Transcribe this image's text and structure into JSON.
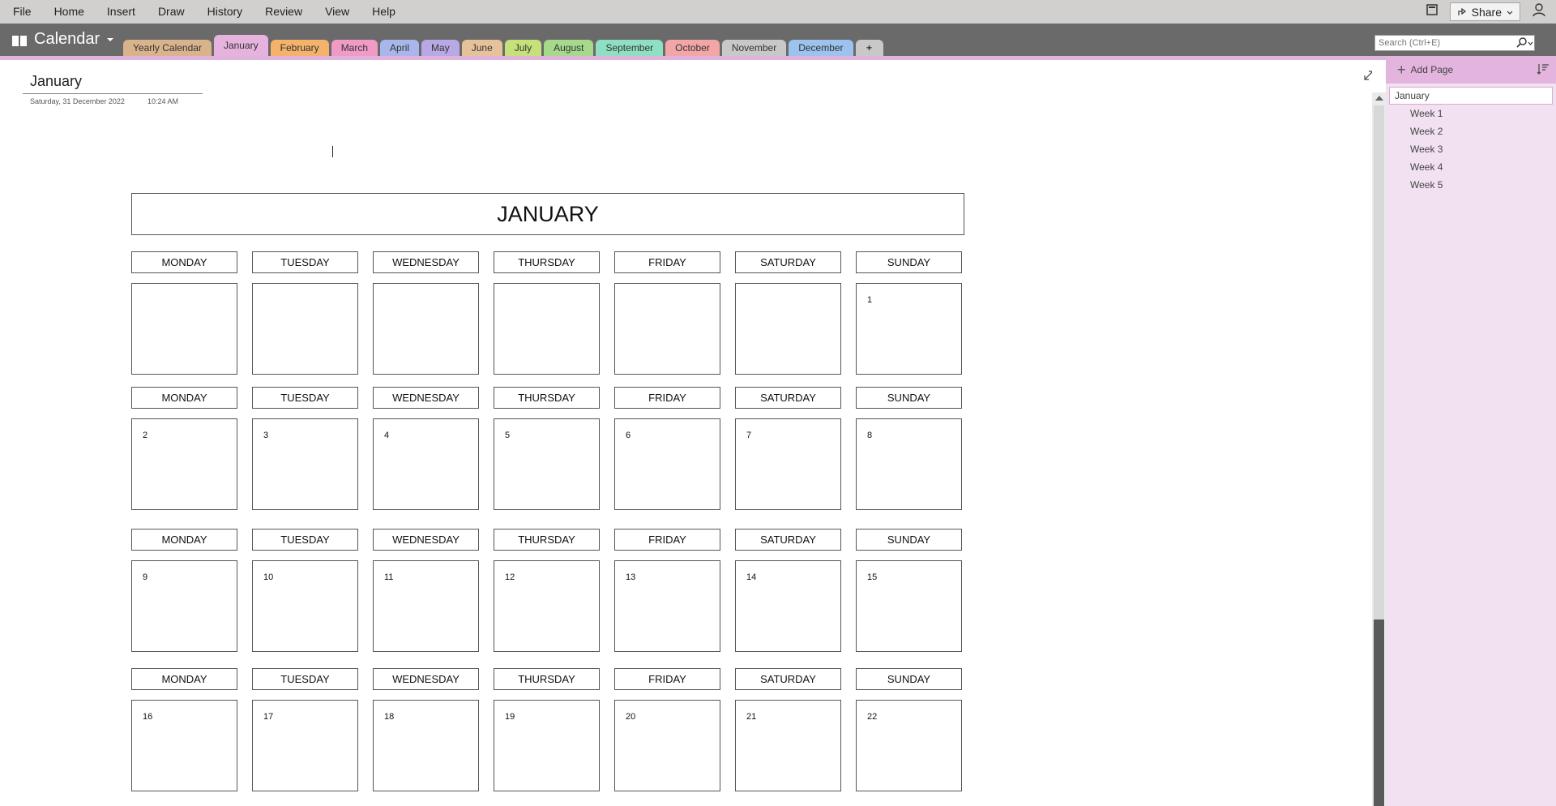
{
  "menu": [
    "File",
    "Home",
    "Insert",
    "Draw",
    "History",
    "Review",
    "View",
    "Help"
  ],
  "share_label": "Share",
  "notebook": {
    "name": "Calendar"
  },
  "tabs": [
    {
      "label": "Yearly Calendar",
      "color": "#d9b38c"
    },
    {
      "label": "January",
      "color": "#e6b3de",
      "active": true
    },
    {
      "label": "February",
      "color": "#f5b26b"
    },
    {
      "label": "March",
      "color": "#f09ac6"
    },
    {
      "label": "April",
      "color": "#a9b6ec"
    },
    {
      "label": "May",
      "color": "#b8a9e6"
    },
    {
      "label": "June",
      "color": "#e6c29a"
    },
    {
      "label": "July",
      "color": "#c6e07a"
    },
    {
      "label": "August",
      "color": "#a6d98c"
    },
    {
      "label": "September",
      "color": "#8fe0c2"
    },
    {
      "label": "October",
      "color": "#f2a6a6"
    },
    {
      "label": "November",
      "color": "#c8c8c8"
    },
    {
      "label": "December",
      "color": "#9cc2ee"
    }
  ],
  "tab_add_label": "+",
  "search_placeholder": "Search (Ctrl+E)",
  "page": {
    "title": "January",
    "date": "Saturday, 31 December 2022",
    "time": "10:24 AM"
  },
  "calendar": {
    "month": "JANUARY",
    "weekdays": [
      "MONDAY",
      "TUESDAY",
      "WEDNESDAY",
      "THURSDAY",
      "FRIDAY",
      "SATURDAY",
      "SUNDAY"
    ],
    "weeks": [
      [
        "",
        "",
        "",
        "",
        "",
        "",
        "1"
      ],
      [
        "2",
        "3",
        "4",
        "5",
        "6",
        "7",
        "8"
      ],
      [
        "9",
        "10",
        "11",
        "12",
        "13",
        "14",
        "15"
      ],
      [
        "16",
        "17",
        "18",
        "19",
        "20",
        "21",
        "22"
      ]
    ]
  },
  "right_pane": {
    "add_page_label": "Add Page",
    "pages": [
      {
        "label": "January",
        "level": 1
      },
      {
        "label": "Week 1",
        "level": 2
      },
      {
        "label": "Week 2",
        "level": 2
      },
      {
        "label": "Week 3",
        "level": 2
      },
      {
        "label": "Week 4",
        "level": 2
      },
      {
        "label": "Week 5",
        "level": 2
      }
    ]
  }
}
